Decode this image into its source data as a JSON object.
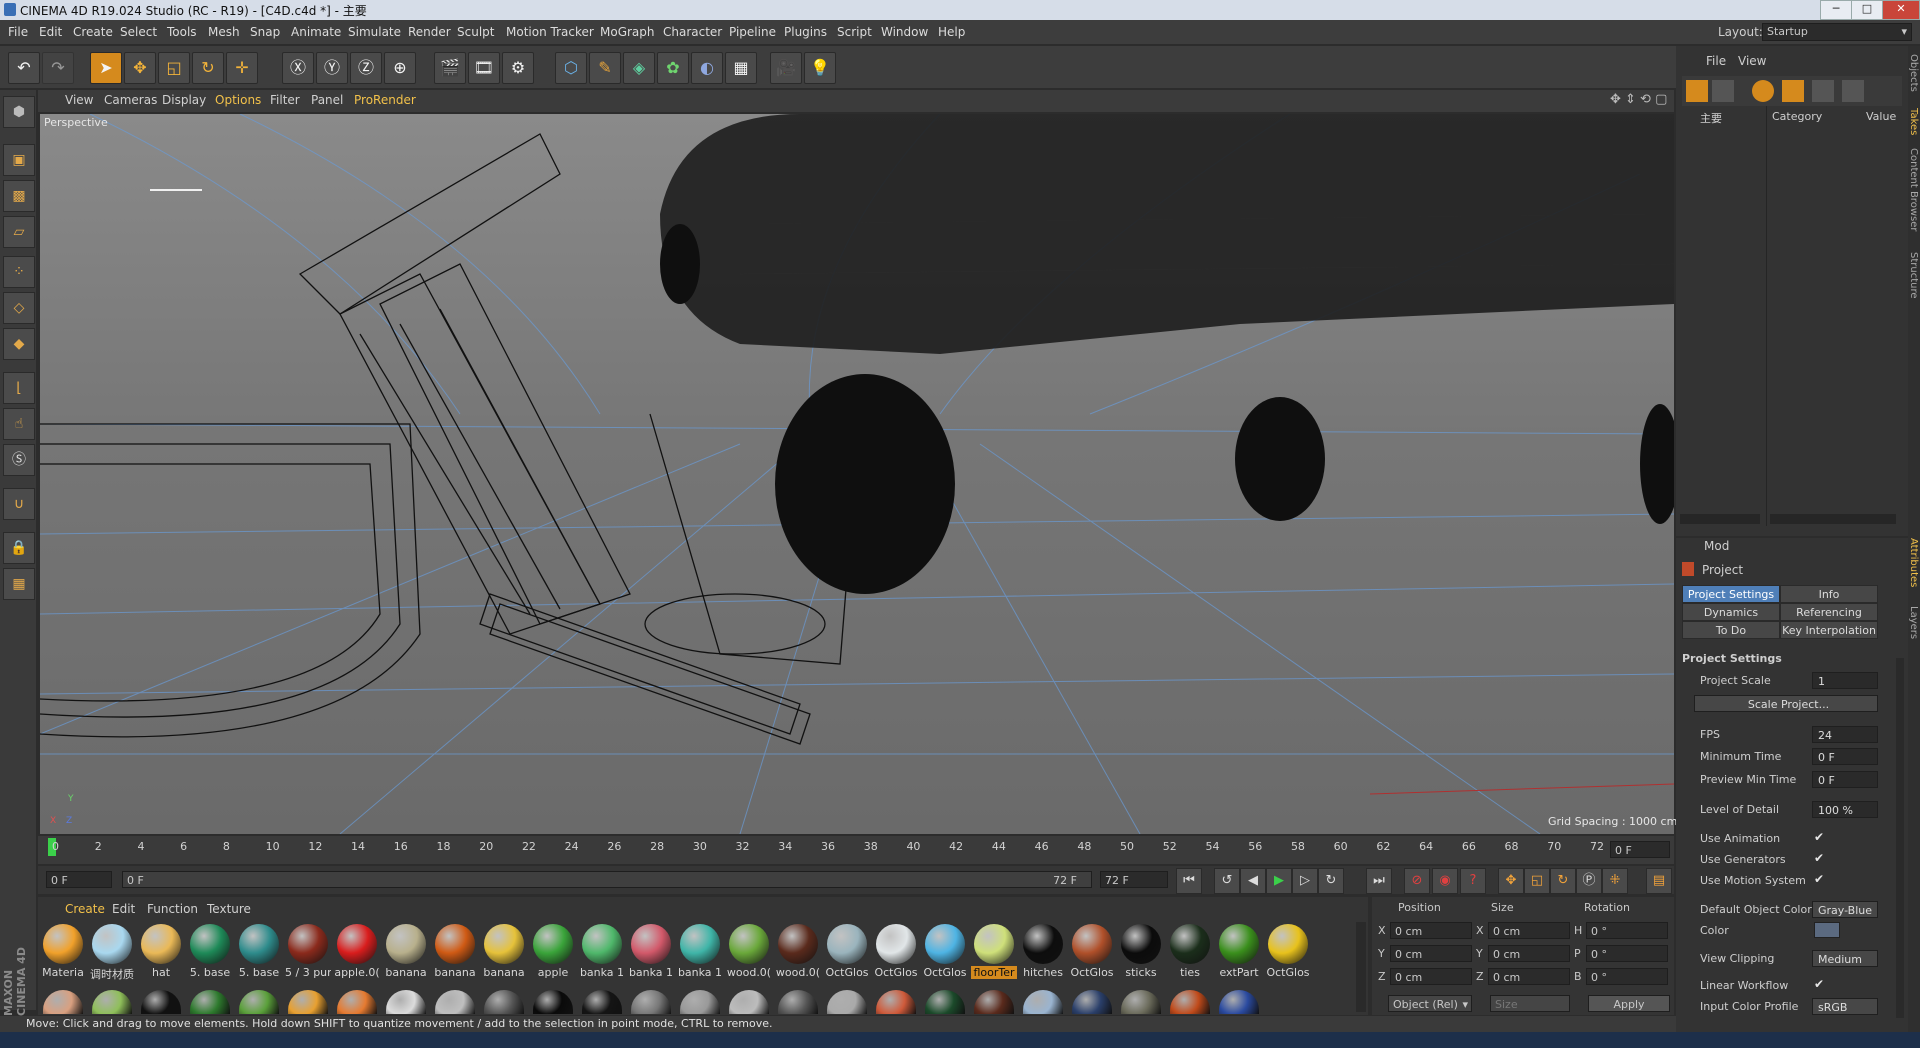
{
  "window": {
    "title": "CINEMA 4D R19.024 Studio (RC - R19) - [C4D.c4d *] - 主要",
    "layout_label": "Layout:",
    "layout_value": "Startup"
  },
  "menubar": [
    "File",
    "Edit",
    "Create",
    "Select",
    "Tools",
    "Mesh",
    "Snap",
    "Animate",
    "Simulate",
    "Render",
    "Sculpt",
    "Motion Tracker",
    "MoGraph",
    "Character",
    "Pipeline",
    "Plugins",
    "Script",
    "Window",
    "Help"
  ],
  "viewport": {
    "menu": [
      "View",
      "Cameras",
      "Display",
      "Options",
      "Filter",
      "Panel",
      "ProRender"
    ],
    "label": "Perspective",
    "grid_spacing": "Grid Spacing : 1000 cm",
    "axis": {
      "x": "X",
      "y": "Y",
      "z": "Z"
    }
  },
  "timeline": {
    "ticks": [
      "0",
      "2",
      "4",
      "6",
      "8",
      "10",
      "12",
      "14",
      "16",
      "18",
      "20",
      "22",
      "24",
      "26",
      "28",
      "30",
      "32",
      "34",
      "36",
      "38",
      "40",
      "42",
      "44",
      "46",
      "48",
      "50",
      "52",
      "54",
      "56",
      "58",
      "60",
      "62",
      "64",
      "66",
      "68",
      "70",
      "72"
    ],
    "current_frame": "0 F",
    "start": "0 F",
    "slider_start": "0 F",
    "slider_end": "72 F",
    "end": "72 F"
  },
  "materials": {
    "menu": [
      "Create",
      "Edit",
      "Function",
      "Texture"
    ],
    "items": [
      {
        "label": "Materia",
        "color": "#f1a12b"
      },
      {
        "label": "调时材质",
        "color": "#a9d8ef"
      },
      {
        "label": "hat",
        "color": "#eab957"
      },
      {
        "label": "5. base",
        "color": "#1e8a58"
      },
      {
        "label": "5. base",
        "color": "#2e8c8c"
      },
      {
        "label": "5 / 3 pur",
        "color": "#8b2a1c"
      },
      {
        "label": "apple.0(",
        "color": "#d91d1d"
      },
      {
        "label": "banana",
        "color": "#b8b08c"
      },
      {
        "label": "banana",
        "color": "#cf5a14"
      },
      {
        "label": "banana",
        "color": "#e6c23a"
      },
      {
        "label": "apple",
        "color": "#3aa43a"
      },
      {
        "label": "banka 1",
        "color": "#4fb86b"
      },
      {
        "label": "banka 1",
        "color": "#d2596a"
      },
      {
        "label": "banka 1",
        "color": "#3fb5a8"
      },
      {
        "label": "wood.0(",
        "color": "#6aa83a"
      },
      {
        "label": "wood.0(",
        "color": "#5a2a1c"
      },
      {
        "label": "OctGlos",
        "color": "#9ab4bd"
      },
      {
        "label": "OctGlos",
        "color": "#e1e6e8"
      },
      {
        "label": "OctGlos",
        "color": "#4eb4e4"
      },
      {
        "label": "floorTer",
        "color": "#cfe07a"
      },
      {
        "label": "hitches",
        "color": "#0d0d0d"
      },
      {
        "label": "OctGlos",
        "color": "#b0502a"
      },
      {
        "label": "sticks",
        "color": "#0b0b0b"
      },
      {
        "label": "ties",
        "color": "#1b2e1b"
      },
      {
        "label": "extPart",
        "color": "#3a8f1c"
      },
      {
        "label": "OctGlos",
        "color": "#e8c21c"
      }
    ],
    "row2_colors": [
      "#d9a080",
      "#8fbf5a",
      "#111",
      "#2d7a2d",
      "#5aa03a",
      "#e8a030",
      "#e67a30",
      "#dcdcdc",
      "#bfbfbf",
      "#555",
      "#0a0a0a",
      "#141414",
      "#777",
      "#999",
      "#bcbcbc",
      "#555",
      "#aaaaaa",
      "#cf5a3a",
      "#1b4a2a",
      "#5a2a1c",
      "#9ab4d0",
      "#2a3f6a",
      "#6a6a5a",
      "#c04a1a",
      "#2a4aa0"
    ],
    "selected_label": "floorTer"
  },
  "coordinates": {
    "headers": [
      "Position",
      "Size",
      "Rotation"
    ],
    "rows": [
      {
        "a": "X",
        "pos": "0 cm",
        "b": "X",
        "size": "0 cm",
        "c": "H",
        "rot": "0 °"
      },
      {
        "a": "Y",
        "pos": "0 cm",
        "b": "Y",
        "size": "0 cm",
        "c": "P",
        "rot": "0 °"
      },
      {
        "a": "Z",
        "pos": "0 cm",
        "b": "Z",
        "size": "0 cm",
        "c": "B",
        "rot": "0 °"
      }
    ],
    "mode": "Object (Rel)",
    "size_mode": "Size",
    "apply": "Apply"
  },
  "status": "Move: Click and drag to move elements. Hold down SHIFT to quantize movement / add to the selection in point mode, CTRL to remove.",
  "object_panel": {
    "menu": [
      "File",
      "View"
    ],
    "headers": [
      "Category",
      "Value"
    ],
    "object": "主要"
  },
  "side_tabs": [
    "Objects",
    "Takes",
    "Content Browser",
    "Structure",
    "Attributes",
    "Layers"
  ],
  "attributes": {
    "mode": "Mod",
    "title": "Project",
    "tabs": [
      [
        "Project Settings",
        "Info"
      ],
      [
        "Dynamics",
        "Referencing"
      ],
      [
        "To Do",
        "Key Interpolation"
      ]
    ],
    "section": "Project Settings",
    "project_scale": {
      "label": "Project Scale",
      "value": "1"
    },
    "scale_button": "Scale Project...",
    "fps": {
      "label": "FPS",
      "value": "24"
    },
    "min_time": {
      "label": "Minimum Time",
      "value": "0 F"
    },
    "preview_min": {
      "label": "Preview Min Time",
      "value": "0 F"
    },
    "lod": {
      "label": "Level of Detail",
      "value": "100 %"
    },
    "use_animation": "Use Animation",
    "use_generators": "Use Generators",
    "use_motion": "Use Motion System",
    "default_color": {
      "label": "Default Object Color",
      "value": "Gray-Blue"
    },
    "color": "Color",
    "view_clipping": {
      "label": "View Clipping",
      "value": "Medium"
    },
    "linear_workflow": "Linear Workflow",
    "input_color_profile": {
      "label": "Input Color Profile",
      "value": "sRGB"
    }
  },
  "colors": {
    "accent_orange": "#d58a1d",
    "accent_blue": "#4f7fb8"
  },
  "branding": "MAXON CINEMA 4D"
}
